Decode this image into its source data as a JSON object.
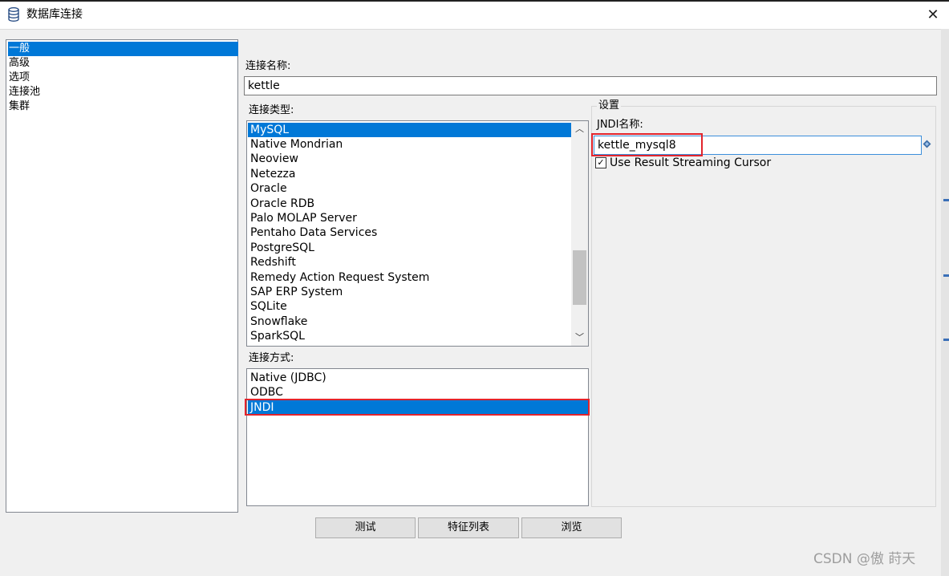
{
  "window": {
    "title": "数据库连接",
    "title_icon": "database-icon",
    "close_glyph": "✕"
  },
  "nav": {
    "items": [
      {
        "label": "一般",
        "selected": true
      },
      {
        "label": "高级",
        "selected": false
      },
      {
        "label": "选项",
        "selected": false
      },
      {
        "label": "连接池",
        "selected": false
      },
      {
        "label": "集群",
        "selected": false
      }
    ]
  },
  "form": {
    "connection_name_label": "连接名称:",
    "connection_name_value": "kettle",
    "connection_type_label": "连接类型:",
    "connection_types": [
      {
        "label": "MySQL",
        "selected": true
      },
      {
        "label": "Native Mondrian",
        "selected": false
      },
      {
        "label": "Neoview",
        "selected": false
      },
      {
        "label": "Netezza",
        "selected": false
      },
      {
        "label": "Oracle",
        "selected": false
      },
      {
        "label": "Oracle RDB",
        "selected": false
      },
      {
        "label": "Palo MOLAP Server",
        "selected": false
      },
      {
        "label": "Pentaho Data Services",
        "selected": false
      },
      {
        "label": "PostgreSQL",
        "selected": false
      },
      {
        "label": "Redshift",
        "selected": false
      },
      {
        "label": "Remedy Action Request System",
        "selected": false
      },
      {
        "label": "SAP ERP System",
        "selected": false
      },
      {
        "label": "SQLite",
        "selected": false
      },
      {
        "label": "Snowflake",
        "selected": false
      },
      {
        "label": "SparkSQL",
        "selected": false
      }
    ],
    "access_label": "连接方式:",
    "access_methods": [
      {
        "label": "Native (JDBC)",
        "selected": false
      },
      {
        "label": "ODBC",
        "selected": false
      },
      {
        "label": "JNDI",
        "selected": true
      }
    ]
  },
  "settings": {
    "legend": "设置",
    "jndi_name_label": "JNDI名称:",
    "jndi_name_value": "kettle_mysql8",
    "streaming_cursor_label": "Use Result Streaming Cursor",
    "streaming_cursor_checked": true,
    "variable_icon": "diamond-variable-icon"
  },
  "buttons": {
    "test": "测试",
    "features": "特征列表",
    "explore": "浏览"
  },
  "watermark": "CSDN @傲  莳天",
  "colors": {
    "selection": "#0078d7",
    "highlight_box": "#e2242c",
    "dialog_bg": "#f0f0f0"
  }
}
